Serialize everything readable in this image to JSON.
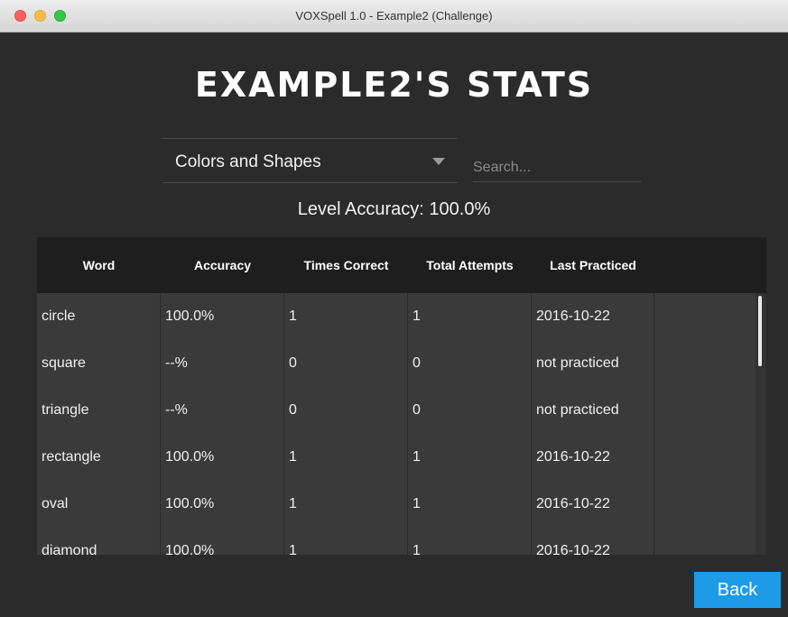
{
  "window": {
    "title": "VOXSpell 1.0 - Example2 (Challenge)"
  },
  "heading": "Example2's Stats",
  "level_select": {
    "selected": "Colors and Shapes"
  },
  "search": {
    "placeholder": "Search...",
    "value": ""
  },
  "level_accuracy": "Level Accuracy: 100.0%",
  "table": {
    "headers": [
      "Word",
      "Accuracy",
      "Times Correct",
      "Total Attempts",
      "Last Practiced",
      ""
    ],
    "rows": [
      [
        "circle",
        "100.0%",
        "1",
        "1",
        "2016-10-22"
      ],
      [
        "square",
        "--%",
        "0",
        "0",
        "not practiced"
      ],
      [
        "triangle",
        "--%",
        "0",
        "0",
        "not practiced"
      ],
      [
        "rectangle",
        "100.0%",
        "1",
        "1",
        "2016-10-22"
      ],
      [
        "oval",
        "100.0%",
        "1",
        "1",
        "2016-10-22"
      ],
      [
        "diamond",
        "100.0%",
        "1",
        "1",
        "2016-10-22"
      ]
    ]
  },
  "buttons": {
    "back": "Back"
  }
}
